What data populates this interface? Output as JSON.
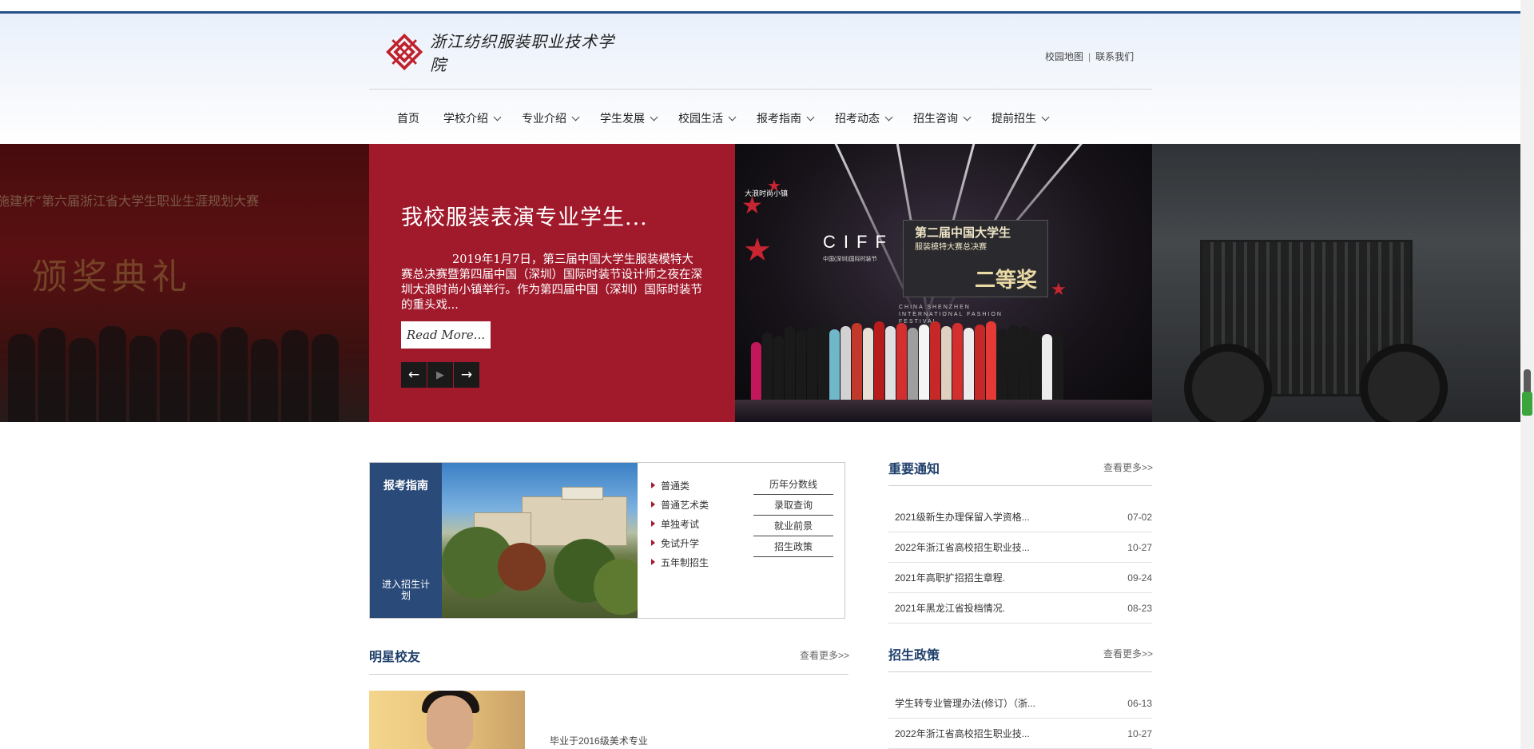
{
  "header": {
    "school_name": "浙江纺织服装职业技术学院",
    "links": [
      "校园地图",
      "联系我们"
    ],
    "link_separator": "|"
  },
  "nav": {
    "items": [
      {
        "label": "首页",
        "has_caret": false
      },
      {
        "label": "学校介绍",
        "has_caret": true
      },
      {
        "label": "专业介绍",
        "has_caret": true
      },
      {
        "label": "学生发展",
        "has_caret": true
      },
      {
        "label": "校园生活",
        "has_caret": true
      },
      {
        "label": "报考指南",
        "has_caret": true
      },
      {
        "label": "招考动态",
        "has_caret": true
      },
      {
        "label": "招生咨询",
        "has_caret": true
      },
      {
        "label": "提前招生",
        "has_caret": true
      }
    ]
  },
  "slider": {
    "title": "我校服装表演专业学生...",
    "summary": "2019年1月7日，第三届中国大学生服装模特大赛总决赛暨第四届中国（深圳）国际时装节设计师之夜在深圳大浪时尚小镇举行。作为第四届中国（深圳）国际时装节的重头戏...",
    "read_more": "Read More...",
    "prev_icon": "arrow-left-icon",
    "play_icon": "play-icon",
    "next_icon": "arrow-right-icon",
    "left_banner_text": "德施建杯”第六届浙江省大学生职业生涯规划大赛",
    "left_banner_big": "颁奖典礼",
    "stage_title": "第二届中国大学生",
    "stage_subtitle": "服装模特大赛总决赛",
    "stage_award": "二等奖",
    "stage_ciff": "CIFF",
    "stage_ciff_sub": "中国(深圳)国际时装节",
    "stage_festival": "CHINA SHENZHEN INTERNATIONAL FASHION FESTIVAL",
    "stage_brand": "大浪时尚小镇"
  },
  "guide": {
    "title": "报考指南",
    "enter": "进入招生计划",
    "list": [
      "普通类",
      "普通艺术类",
      "单独考试",
      "免试升学",
      "五年制招生"
    ],
    "links": [
      "历年分数线",
      "录取查询",
      "就业前景",
      "招生政策"
    ]
  },
  "notices": {
    "title": "重要通知",
    "more": "查看更多>>",
    "items": [
      {
        "text": "2021级新生办理保留入学资格...",
        "date": "07-02"
      },
      {
        "text": "2022年浙江省高校招生职业技...",
        "date": "10-27"
      },
      {
        "text": "2021年高职扩招招生章程.",
        "date": "09-24"
      },
      {
        "text": "2021年黑龙江省投档情况.",
        "date": "08-23"
      }
    ]
  },
  "alumni": {
    "title": "明星校友",
    "more": "查看更多>>",
    "caption": "毕业于2016级美术专业"
  },
  "policy": {
    "title": "招生政策",
    "more": "查看更多>>",
    "items": [
      {
        "text": "学生转专业管理办法(修订）（浙...",
        "date": "06-13"
      },
      {
        "text": "2022年浙江省高校招生职业技...",
        "date": "10-27"
      }
    ]
  },
  "colors": {
    "brand_blue": "#25508a",
    "caption_red": "#a11a2c",
    "guide_blue": "#2a4a7a",
    "section_title": "#1f3f6b"
  }
}
